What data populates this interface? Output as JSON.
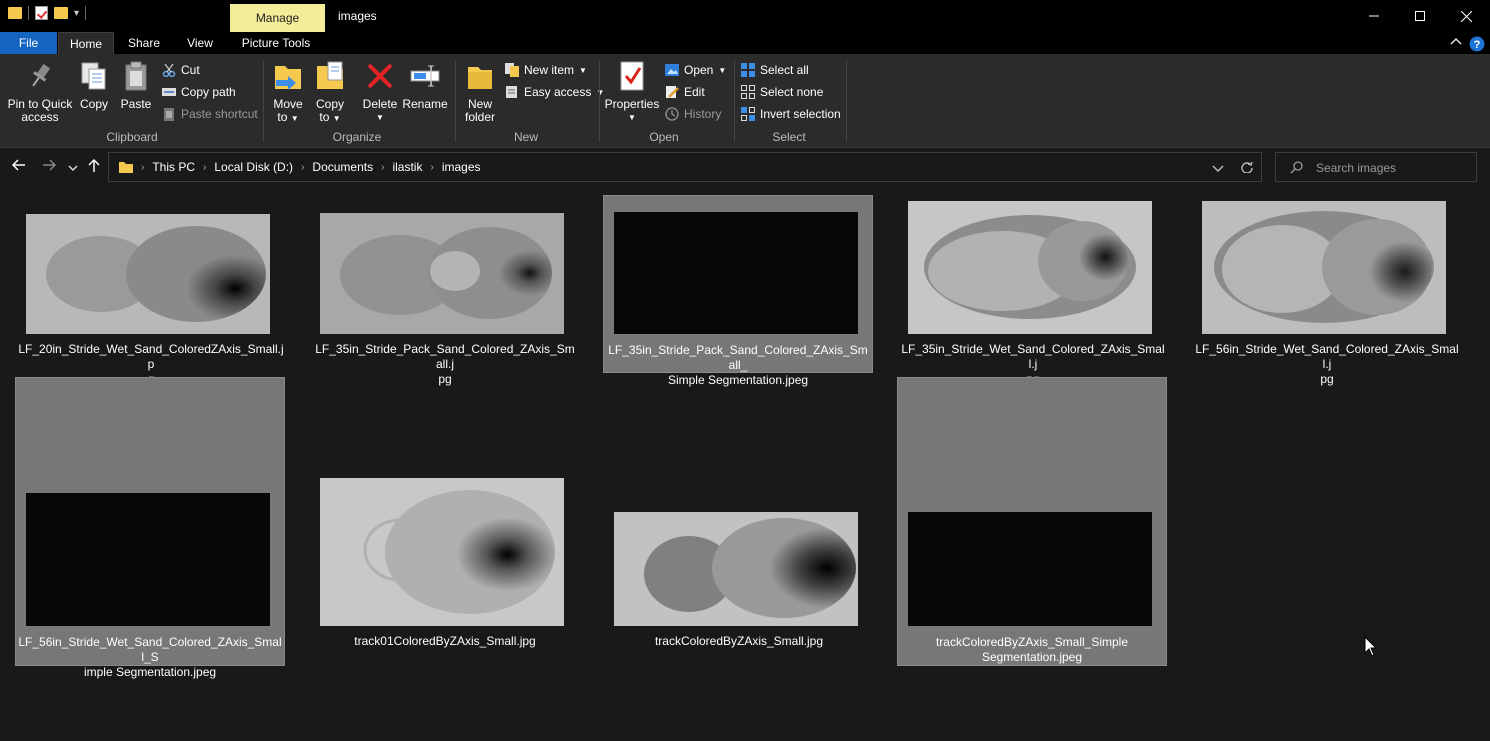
{
  "window": {
    "title": "images",
    "context_tab": "Manage",
    "minimize": "—",
    "maximize": "☐",
    "close": "✕"
  },
  "tabs": {
    "file": "File",
    "home": "Home",
    "share": "Share",
    "view": "View",
    "picture_tools": "Picture Tools"
  },
  "ribbon": {
    "clipboard": {
      "label": "Clipboard",
      "pin_line1": "Pin to Quick",
      "pin_line2": "access",
      "copy": "Copy",
      "paste": "Paste",
      "cut": "Cut",
      "copy_path": "Copy path",
      "paste_shortcut": "Paste shortcut"
    },
    "organize": {
      "label": "Organize",
      "move_line1": "Move",
      "move_line2": "to",
      "copy_line1": "Copy",
      "copy_line2": "to",
      "delete": "Delete",
      "rename": "Rename"
    },
    "new": {
      "label": "New",
      "new_folder_line1": "New",
      "new_folder_line2": "folder",
      "new_item": "New item",
      "easy_access": "Easy access"
    },
    "open": {
      "label": "Open",
      "properties": "Properties",
      "open": "Open",
      "edit": "Edit",
      "history": "History"
    },
    "select": {
      "label": "Select",
      "select_all": "Select all",
      "select_none": "Select none",
      "invert_selection": "Invert selection"
    }
  },
  "address": {
    "crumbs": [
      "This PC",
      "Local Disk (D:)",
      "Documents",
      "ilastik",
      "images"
    ],
    "search_placeholder": "Search images"
  },
  "files": [
    {
      "name_line1": "LF_20in_Stride_Wet_Sand_ColoredZAxis_Small.jp",
      "name_line2": "g",
      "selected": false,
      "kind": "photo"
    },
    {
      "name_line1": "LF_35in_Stride_Pack_Sand_Colored_ZAxis_Small.j",
      "name_line2": "pg",
      "selected": false,
      "kind": "photo"
    },
    {
      "name_line1": "LF_35in_Stride_Pack_Sand_Colored_ZAxis_Small_",
      "name_line2": "Simple Segmentation.jpeg",
      "selected": true,
      "kind": "black"
    },
    {
      "name_line1": "LF_35in_Stride_Wet_Sand_Colored_ZAxis_Small.j",
      "name_line2": "pg",
      "selected": false,
      "kind": "photo"
    },
    {
      "name_line1": "LF_56in_Stride_Wet_Sand_Colored_ZAxis_Small.j",
      "name_line2": "pg",
      "selected": false,
      "kind": "photo"
    },
    {
      "name_line1": "LF_56in_Stride_Wet_Sand_Colored_ZAxis_Small_S",
      "name_line2": "imple Segmentation.jpeg",
      "selected": true,
      "kind": "black"
    },
    {
      "name_line1": "track01ColoredByZAxis_Small.jpg",
      "name_line2": "",
      "selected": false,
      "kind": "photo"
    },
    {
      "name_line1": "trackColoredByZAxis_Small.jpg",
      "name_line2": "",
      "selected": false,
      "kind": "photo"
    },
    {
      "name_line1": "trackColoredByZAxis_Small_Simple",
      "name_line2": "Segmentation.jpeg",
      "selected": true,
      "kind": "black"
    }
  ],
  "colors": {
    "accent": "#1565c0",
    "manage_tab": "#f3ec98",
    "selection": "#777777",
    "background": "#191919"
  }
}
